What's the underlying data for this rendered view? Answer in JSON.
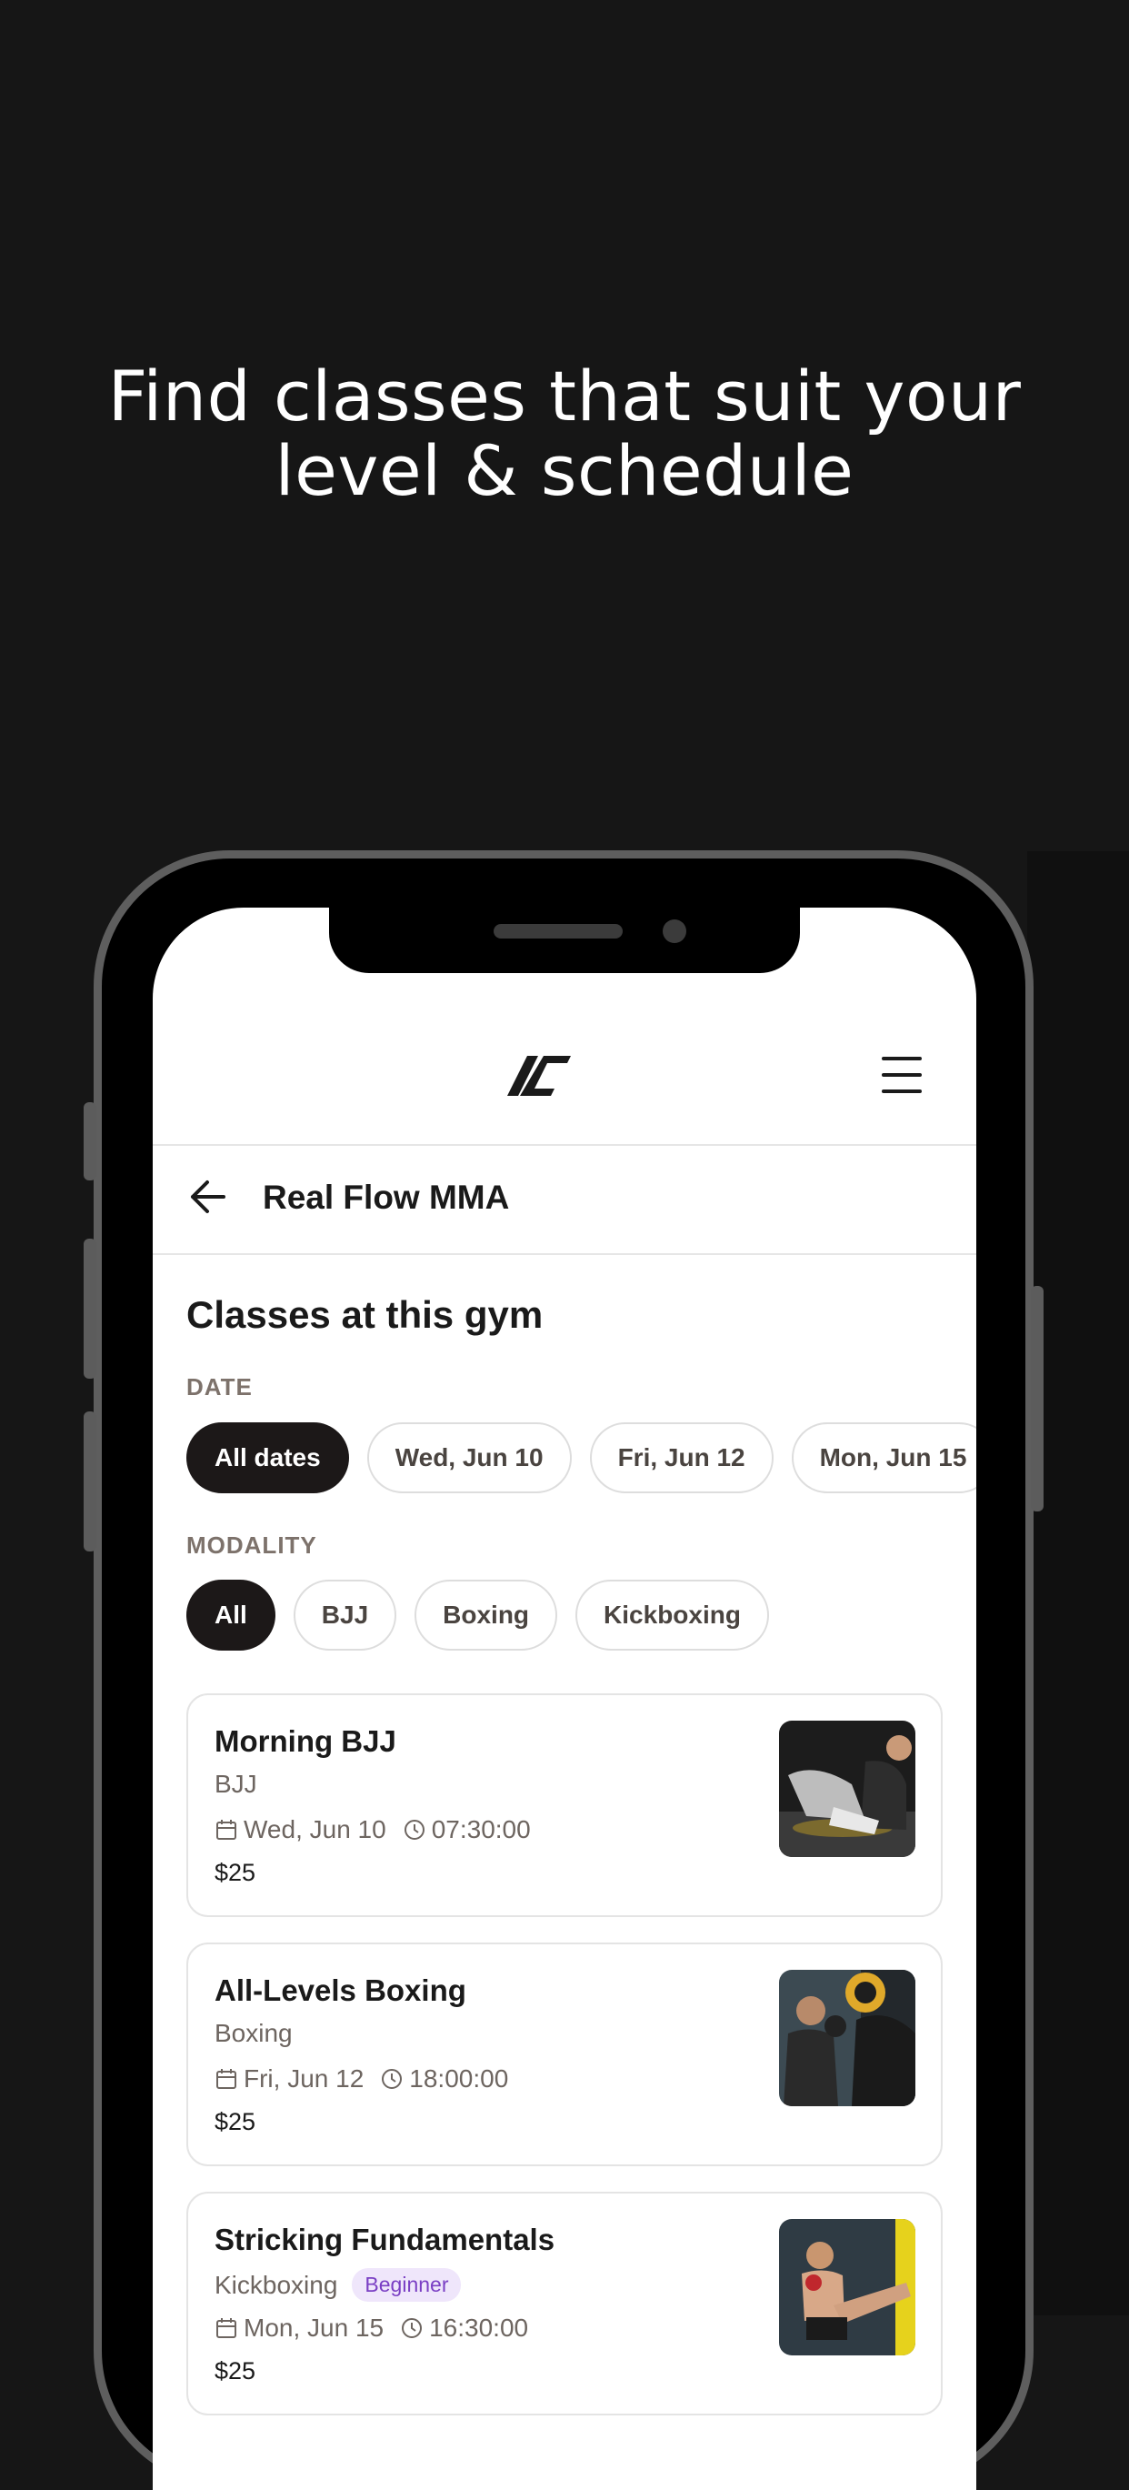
{
  "headline": {
    "line1": "Find classes that suit your",
    "line2": "level & schedule"
  },
  "header": {
    "logo_icon": "brand-logo-icon",
    "menu_icon": "hamburger-menu-icon"
  },
  "gym_bar": {
    "back_icon": "arrow-left-icon",
    "title": "Real Flow MMA"
  },
  "section_title": "Classes at this gym",
  "date_filter": {
    "label": "DATE",
    "chips": [
      "All dates",
      "Wed, Jun 10",
      "Fri, Jun 12",
      "Mon, Jun 15"
    ],
    "selected": "All dates"
  },
  "modality_filter": {
    "label": "MODALITY",
    "chips": [
      "All",
      "BJJ",
      "Boxing",
      "Kickboxing"
    ],
    "selected": "All"
  },
  "classes": [
    {
      "title": "Morning BJJ",
      "modality": "BJJ",
      "badge": "",
      "date": "Wed, Jun 10",
      "time": "07:30:00",
      "price": "$25"
    },
    {
      "title": "All-Levels Boxing",
      "modality": "Boxing",
      "badge": "",
      "date": "Fri, Jun 12",
      "time": "18:00:00",
      "price": "$25"
    },
    {
      "title": "Stricking Fundamentals",
      "modality": "Kickboxing",
      "badge": "Beginner",
      "date": "Mon, Jun 15",
      "time": "16:30:00",
      "price": "$25"
    }
  ],
  "colors": {
    "background": "#161616",
    "active_chip": "#1c1818",
    "badge_text": "#7a3fc4",
    "badge_bg": "#efe6fb"
  }
}
